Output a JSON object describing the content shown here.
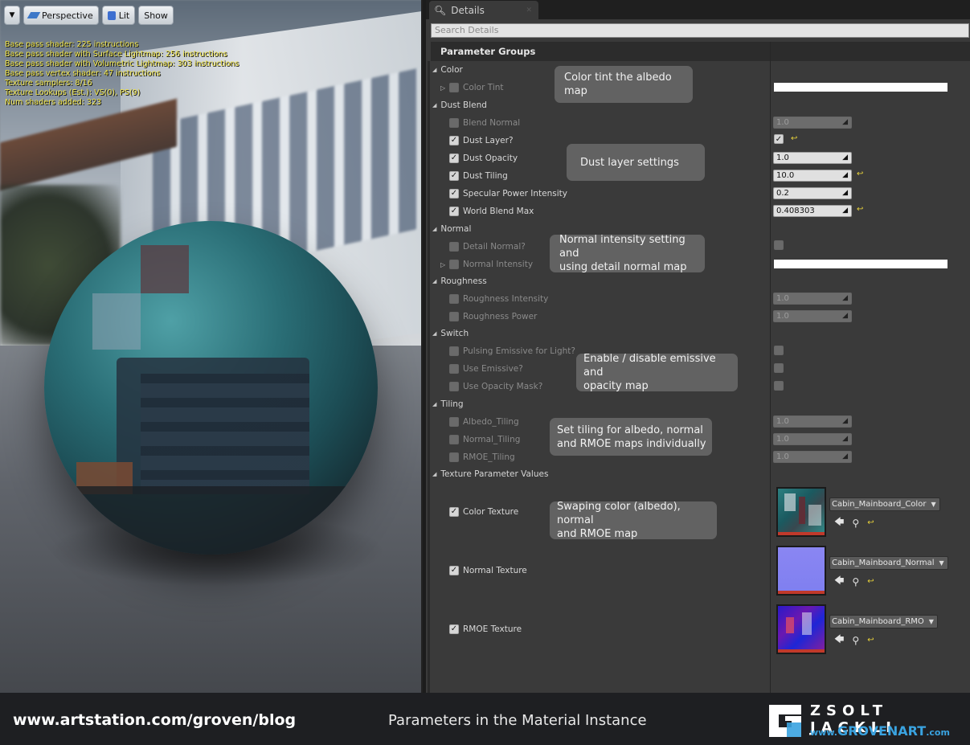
{
  "viewport": {
    "menu_icon": "chevron-down-icon",
    "buttons": {
      "perspective": "Perspective",
      "lit": "Lit",
      "show": "Show"
    },
    "stats": [
      "Base pass shader: 225 instructions",
      "Base pass shader with Surface Lightmap: 256 instructions",
      "Base pass shader with Volumetric Lightmap: 303 instructions",
      "Base pass vertex shader: 47 instructions",
      "Texture samplers: 8/16",
      "Texture Lookups (Est.): VS(0), PS(9)",
      "Num shaders added: 323"
    ]
  },
  "details": {
    "tab_label": "Details",
    "tab_icon": "magnifier-icon",
    "search_placeholder": "Search Details",
    "section_title": "Parameter Groups",
    "groups": {
      "color": "Color",
      "dust_blend": "Dust Blend",
      "normal": "Normal",
      "roughness": "Roughness",
      "switch": "Switch",
      "tiling": "Tiling",
      "texture": "Texture Parameter Values"
    },
    "params": {
      "color_tint": "Color Tint",
      "blend_normal": "Blend Normal",
      "dust_layer": "Dust Layer?",
      "dust_opacity": "Dust Opacity",
      "dust_tiling": "Dust Tiling",
      "specular_power_intensity": "Specular Power Intensity",
      "world_blend_max": "World Blend Max",
      "detail_normal": "Detail Normal?",
      "normal_intensity": "Normal Intensity",
      "roughness_intensity": "Roughness Intensity",
      "roughness_power": "Roughness Power",
      "pulsing_emissive": "Pulsing Emissive for Light?",
      "use_emissive": "Use Emissive?",
      "use_opacity_mask": "Use Opacity Mask?",
      "albedo_tiling": "Albedo_Tiling",
      "normal_tiling": "Normal_Tiling",
      "rmoe_tiling": "RMOE_Tiling",
      "color_texture": "Color Texture",
      "normal_texture": "Normal Texture",
      "rmoe_texture": "RMOE Texture"
    },
    "values": {
      "blend_normal": "1.0",
      "dust_opacity": "1.0",
      "dust_tiling": "10.0",
      "specular_power_intensity": "0.2",
      "world_blend_max": "0.408303",
      "roughness_intensity": "1.0",
      "roughness_power": "1.0",
      "albedo_tiling": "1.0",
      "normal_tiling": "1.0",
      "rmoe_tiling": "1.0"
    },
    "textures": {
      "color": "Cabin_Mainboard_Color",
      "normal": "Cabin_Mainboard_Normal",
      "rmoe": "Cabin_Mainboard_RMO"
    },
    "tooltips": {
      "color": "Color tint the albedo map",
      "dust": "Dust layer settings",
      "normal_1": "Normal intensity setting and",
      "normal_2": "using detail normal map",
      "switch_1": "Enable / disable emissive and",
      "switch_2": "opacity map",
      "tiling_1": "Set tiling for albedo, normal",
      "tiling_2": "and RMOE maps individually",
      "texture_1": "Swaping color (albedo), normal",
      "texture_2": "and RMOE map"
    }
  },
  "footer": {
    "url": "www.artstation.com/groven/blog",
    "caption": "Parameters in the Material Instance",
    "brand_name": "Zsolt Jackli",
    "brand_www": "www.",
    "brand_domain": "GROVENART",
    "brand_tld": ".com"
  },
  "colors": {
    "accent_yellow": "#e8d23a",
    "brand_blue": "#3aa3e0"
  }
}
